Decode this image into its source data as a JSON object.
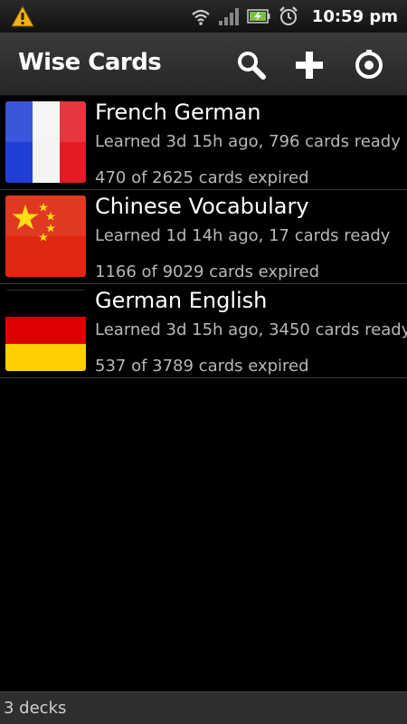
{
  "status_bar": {
    "time": "10:59 pm",
    "icons": [
      "warning-icon",
      "wifi-icon",
      "signal-icon",
      "battery-charging-icon",
      "alarm-icon"
    ]
  },
  "action_bar": {
    "title": "Wise Cards",
    "actions": [
      "search-icon",
      "add-icon",
      "sync-icon"
    ]
  },
  "decks": [
    {
      "name": "French German",
      "learned": "Learned 3d 15h ago, 796 cards ready",
      "expired": "470 of 2625 cards expired",
      "flag": "france-flag-icon"
    },
    {
      "name": "Chinese Vocabulary",
      "learned": "Learned 1d 14h ago, 17 cards ready",
      "expired": "1166 of 9029 cards expired",
      "flag": "china-flag-icon"
    },
    {
      "name": "German English",
      "learned": "Learned 3d 15h ago, 3450 cards ready",
      "expired": "537 of 3789 cards expired",
      "flag": "germany-flag-icon"
    }
  ],
  "footer": {
    "text": "3 decks"
  },
  "colors": {
    "background": "#000000",
    "action_bar": "#303030",
    "secondary_text": "#b8b8b8",
    "warning": "#f2b21a",
    "battery": "#7bc043"
  }
}
